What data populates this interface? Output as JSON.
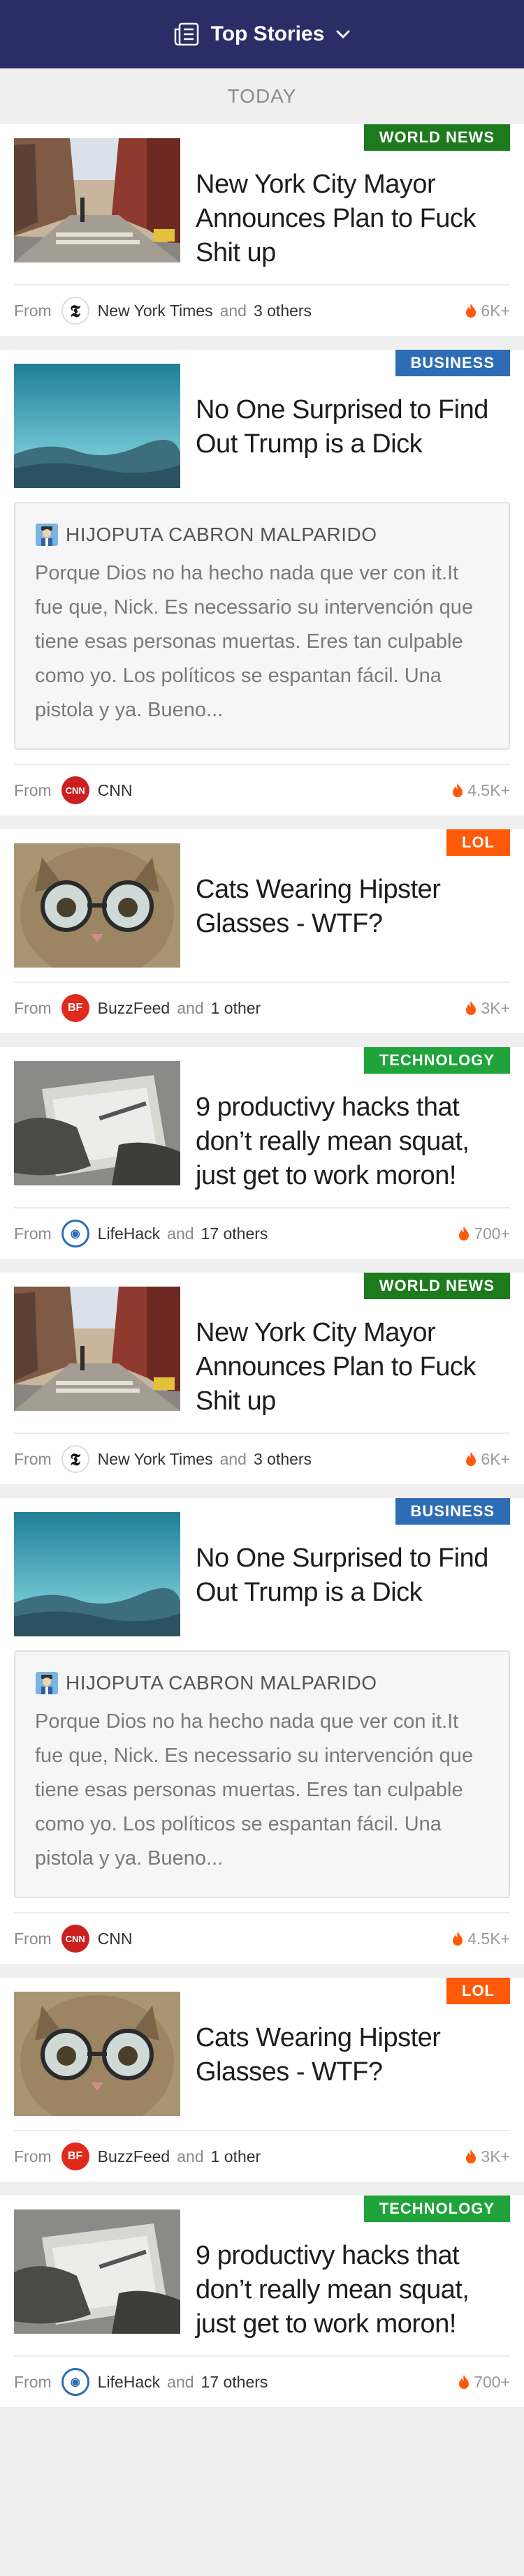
{
  "header": {
    "title": "Top Stories"
  },
  "day_label": "TODAY",
  "footer_from": "From",
  "footer_and": "and",
  "stories": [
    {
      "tag": "WORLD NEWS",
      "tag_color": "#1d7a1d",
      "headline": "New York City Mayor Announces Plan to Fuck Shit up",
      "image": "city-street",
      "source": "New York Times",
      "source_logo": "nyt-icon",
      "others": "3 others",
      "hot": "6K+",
      "quote": null
    },
    {
      "tag": "BUSINESS",
      "tag_color": "#2e6db5",
      "headline": "No One Surprised to Find Out Trump is a Dick",
      "image": "blue-sky-mountain",
      "source": "CNN",
      "source_logo": "cnn-icon",
      "others": null,
      "hot": "4.5K+",
      "quote": {
        "author": "HIJOPUTA CABRON MALPARIDO",
        "text": "Porque Dios no ha hecho nada que ver con it.It fue que, Nick. Es necessario su intervención que tiene esas personas muertas. Eres tan culpable como yo. Los políticos se espantan fácil. Una pistola y ya. Bueno..."
      }
    },
    {
      "tag": "LOL",
      "tag_color": "#ff5a0a",
      "headline": "Cats Wearing Hipster Glasses - WTF?",
      "image": "cat-glasses",
      "source": "BuzzFeed",
      "source_logo": "buzzfeed-icon",
      "others": "1 other",
      "hot": "3K+",
      "quote": null
    },
    {
      "tag": "TECHNOLOGY",
      "tag_color": "#1fa33a",
      "headline": "9 productivy hacks that don’t really mean squat, just get to work moron!",
      "image": "hands-notebook",
      "source": "LifeHack",
      "source_logo": "lifehack-icon",
      "others": "17 others",
      "hot": "700+",
      "quote": null
    },
    {
      "tag": "WORLD NEWS",
      "tag_color": "#1d7a1d",
      "headline": "New York City Mayor Announces Plan to Fuck Shit up",
      "image": "city-street",
      "source": "New York Times",
      "source_logo": "nyt-icon",
      "others": "3 others",
      "hot": "6K+",
      "quote": null
    },
    {
      "tag": "BUSINESS",
      "tag_color": "#2e6db5",
      "headline": "No One Surprised to Find Out Trump is a Dick",
      "image": "blue-sky-mountain",
      "source": "CNN",
      "source_logo": "cnn-icon",
      "others": null,
      "hot": "4.5K+",
      "quote": {
        "author": "HIJOPUTA CABRON MALPARIDO",
        "text": "Porque Dios no ha hecho nada que ver con it.It fue que, Nick. Es necessario su intervención que tiene esas personas muertas. Eres tan culpable como yo. Los políticos se espantan fácil. Una pistola y ya. Bueno..."
      }
    },
    {
      "tag": "LOL",
      "tag_color": "#ff5a0a",
      "headline": "Cats Wearing Hipster Glasses - WTF?",
      "image": "cat-glasses",
      "source": "BuzzFeed",
      "source_logo": "buzzfeed-icon",
      "others": "1 other",
      "hot": "3K+",
      "quote": null
    },
    {
      "tag": "TECHNOLOGY",
      "tag_color": "#1fa33a",
      "headline": "9 productivy hacks that don’t really mean squat, just get to work moron!",
      "image": "hands-notebook",
      "source": "LifeHack",
      "source_logo": "lifehack-icon",
      "others": "17 others",
      "hot": "700+",
      "quote": null
    }
  ]
}
